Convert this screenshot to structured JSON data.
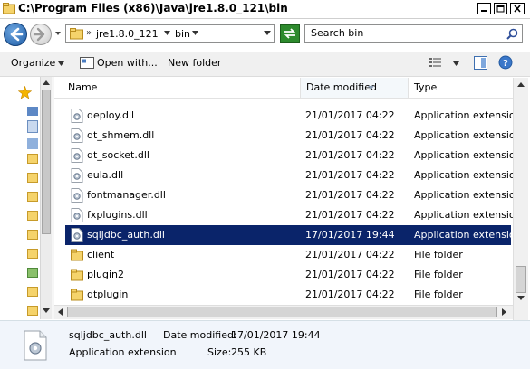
{
  "title": "C:\\Program Files (x86)\\Java\\jre1.8.0_121\\bin",
  "address": {
    "segments": [
      "jre1.8.0_121",
      "bin"
    ]
  },
  "search": {
    "placeholder": "Search bin"
  },
  "toolbar": {
    "organize": "Organize",
    "open_with": "Open with...",
    "new_folder": "New folder"
  },
  "columns": {
    "name": "Name",
    "date": "Date modified",
    "type": "Type"
  },
  "files": [
    {
      "name": "deploy.dll",
      "date": "21/01/2017 04:22",
      "type": "Application extension",
      "kind": "dll"
    },
    {
      "name": "dt_shmem.dll",
      "date": "21/01/2017 04:22",
      "type": "Application extension",
      "kind": "dll"
    },
    {
      "name": "dt_socket.dll",
      "date": "21/01/2017 04:22",
      "type": "Application extension",
      "kind": "dll"
    },
    {
      "name": "eula.dll",
      "date": "21/01/2017 04:22",
      "type": "Application extension",
      "kind": "dll"
    },
    {
      "name": "fontmanager.dll",
      "date": "21/01/2017 04:22",
      "type": "Application extension",
      "kind": "dll"
    },
    {
      "name": "fxplugins.dll",
      "date": "21/01/2017 04:22",
      "type": "Application extension",
      "kind": "dll"
    },
    {
      "name": "sqljdbc_auth.dll",
      "date": "17/01/2017 19:44",
      "type": "Application extension",
      "kind": "dll",
      "selected": true
    },
    {
      "name": "client",
      "date": "21/01/2017 04:22",
      "type": "File folder",
      "kind": "folder"
    },
    {
      "name": "plugin2",
      "date": "21/01/2017 04:22",
      "type": "File folder",
      "kind": "folder"
    },
    {
      "name": "dtplugin",
      "date": "21/01/2017 04:22",
      "type": "File folder",
      "kind": "folder"
    }
  ],
  "details": {
    "name": "sqljdbc_auth.dll",
    "type": "Application extension",
    "date_label": "Date modified:",
    "date_value": "17/01/2017 19:44",
    "size_label": "Size:",
    "size_value": "255 KB"
  },
  "colors": {
    "selection": "#0a246a",
    "folder": "#f5d36b"
  }
}
